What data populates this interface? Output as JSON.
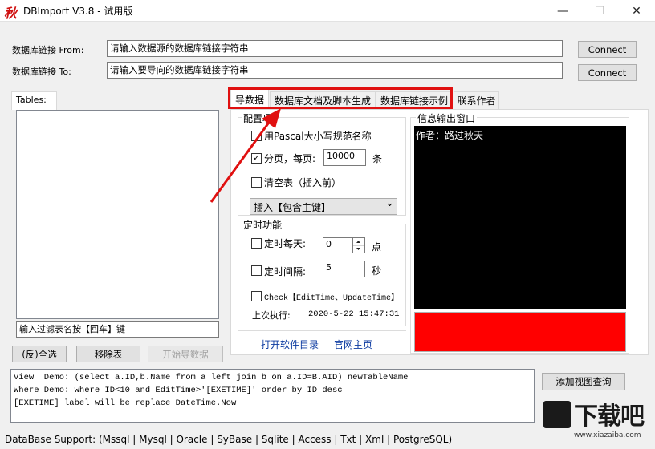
{
  "window": {
    "icon_char": "秋",
    "title": "DBImport V3.8 - 试用版",
    "minimize": "—",
    "maximize": "☐",
    "close": "✕"
  },
  "connection": {
    "from_label": "数据库链接 From:",
    "from_value": "请输入数据源的数据库链接字符串",
    "to_label": "数据库链接 To:",
    "to_value": "请输入要导向的数据库链接字符串",
    "connect_label": "Connect"
  },
  "tables": {
    "tab_label": "Tables:",
    "filter_value": "输入过滤表名按【回车】键",
    "select_all": "(反)全选",
    "remove": "移除表",
    "start": "开始导数据"
  },
  "tabs": [
    "导数据",
    "数据库文档及脚本生成",
    "数据库链接示例",
    "联系作者"
  ],
  "config": {
    "group_title": "配置项",
    "pascal_label": "用Pascal大小写规范名称",
    "pascal_checked": false,
    "paging_label": "分页，每页:",
    "paging_checked": true,
    "paging_value": "10000",
    "paging_unit": "条",
    "truncate_label": "清空表（插入前）",
    "truncate_checked": false,
    "insert_mode": "插入【包含主键】",
    "dropdown_arrow": "⌄"
  },
  "timer": {
    "group_title": "定时功能",
    "daily_label": "定时每天:",
    "daily_checked": false,
    "daily_value": "0",
    "daily_unit": "点",
    "interval_label": "定时间隔:",
    "interval_checked": false,
    "interval_value": "5",
    "interval_unit": "秒",
    "check_label": "Check【EditTime、UpdateTime】",
    "check_checked": false,
    "last_run_label": "上次执行:",
    "last_run_value": "2020-5-22 15:47:31"
  },
  "links": {
    "open_dir": "打开软件目录",
    "homepage": "官网主页"
  },
  "output": {
    "title": "信息输出窗口",
    "text": "作者：路过秋天",
    "status_color": "#ff0000"
  },
  "log": {
    "lines": [
      "View  Demo: (select a.ID,b.Name from a left join b on a.ID=B.AID) newTableName",
      "Where Demo: where ID<10 and EditTime>'[EXETIME]' order by ID desc",
      "[EXETIME] label will be replace DateTime.Now"
    ]
  },
  "add_view_button": "添加视图查询",
  "footer": "DataBase Support:   (Mssql | Mysql | Oracle | SyBase | Sqlite | Access | Txt | Xml | PostgreSQL)",
  "watermark": {
    "text": "下载吧",
    "url": "www.xiazaiba.com"
  },
  "colors": {
    "annotation": "#e01010",
    "status_bar": "#ff0000",
    "output_bg": "#000000"
  }
}
